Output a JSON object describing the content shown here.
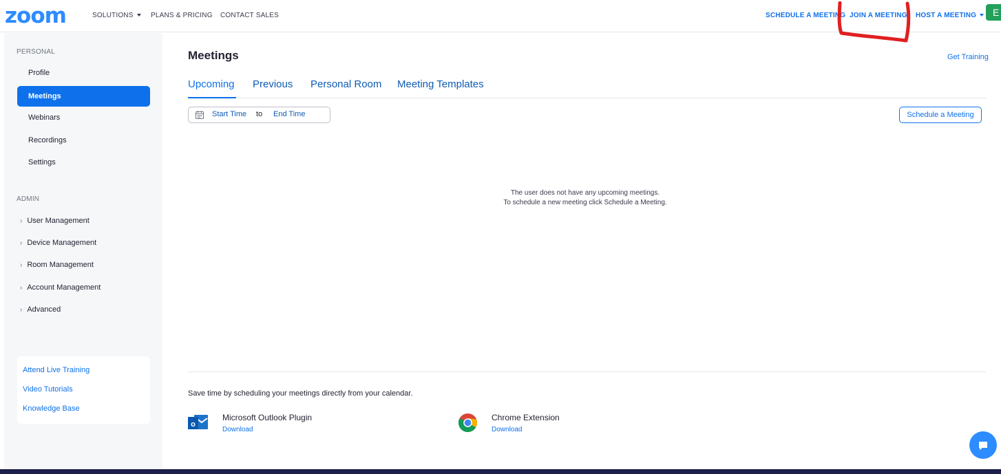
{
  "brand": {
    "logo_text": "zoom"
  },
  "topnav": {
    "solutions": "SOLUTIONS",
    "plans": "PLANS & PRICING",
    "contact": "CONTACT SALES",
    "schedule": "SCHEDULE A MEETING",
    "join": "JOIN A MEETING",
    "host": "HOST A MEETING",
    "avatar_letter": "E"
  },
  "sidebar": {
    "personal_heading": "PERSONAL",
    "personal_items": [
      "Profile",
      "Meetings",
      "Webinars",
      "Recordings",
      "Settings"
    ],
    "active_item": "Meetings",
    "admin_heading": "ADMIN",
    "admin_items": [
      "User Management",
      "Device Management",
      "Room Management",
      "Account Management",
      "Advanced"
    ],
    "help_links": [
      "Attend Live Training",
      "Video Tutorials",
      "Knowledge Base"
    ]
  },
  "main": {
    "title": "Meetings",
    "get_training": "Get Training",
    "tabs": [
      "Upcoming",
      "Previous",
      "Personal Room",
      "Meeting Templates"
    ],
    "active_tab": "Upcoming",
    "date_range": {
      "start": "Start Time",
      "separator": "to",
      "end": "End Time"
    },
    "schedule_button": "Schedule a Meeting",
    "empty_line1": "The user does not have any upcoming meetings.",
    "empty_line2": "To schedule a new meeting click Schedule a Meeting.",
    "calendar_promo": "Save time by scheduling your meetings directly from your calendar.",
    "plugins": [
      {
        "name": "Microsoft Outlook Plugin",
        "link": "Download"
      },
      {
        "name": "Chrome Extension",
        "link": "Download"
      }
    ]
  },
  "colors": {
    "brand_blue": "#2d8cff",
    "link_blue": "#0e71eb",
    "highlight_red": "#e02020",
    "avatar_green": "#23a05a"
  },
  "icons": [
    "calendar-icon",
    "outlook-icon",
    "chrome-icon",
    "chat-icon",
    "chevron-right-icon",
    "caret-down-icon"
  ]
}
